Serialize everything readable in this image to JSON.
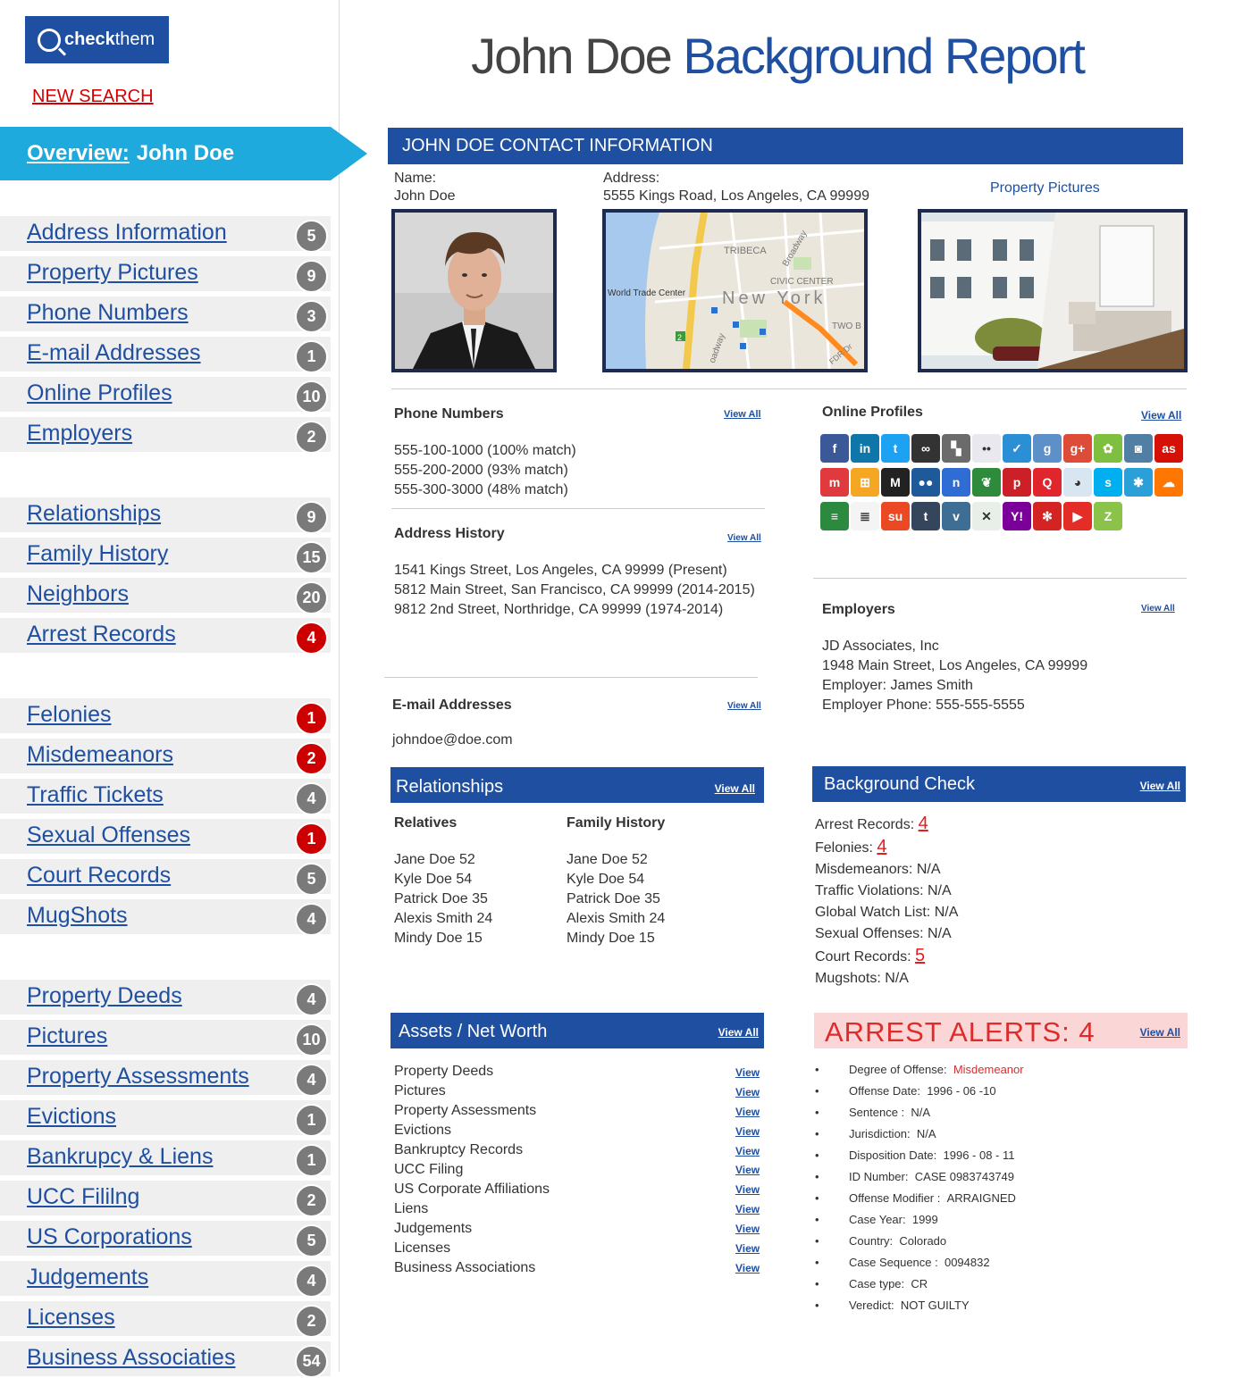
{
  "brand": {
    "logo_bold": "check",
    "logo_rest": "them"
  },
  "sidebar": {
    "new_search": "NEW SEARCH",
    "overview_prefix": "Overview:",
    "overview_name": "John Doe",
    "groups": [
      [
        {
          "label": "Address Information",
          "count": "5",
          "alert": false
        },
        {
          "label": "Property Pictures",
          "count": "9",
          "alert": false
        },
        {
          "label": "Phone Numbers",
          "count": "3",
          "alert": false
        },
        {
          "label": "E-mail Addresses",
          "count": "1",
          "alert": false
        },
        {
          "label": "Online Profiles",
          "count": "10",
          "alert": false
        },
        {
          "label": "Employers",
          "count": "2",
          "alert": false
        }
      ],
      [
        {
          "label": "Relationships",
          "count": "9",
          "alert": false
        },
        {
          "label": "Family History",
          "count": "15",
          "alert": false
        },
        {
          "label": "Neighbors",
          "count": "20",
          "alert": false
        },
        {
          "label": "Arrest Records",
          "count": "4",
          "alert": true
        }
      ],
      [
        {
          "label": "Felonies",
          "count": "1",
          "alert": true
        },
        {
          "label": "Misdemeanors",
          "count": "2",
          "alert": true
        },
        {
          "label": "Traffic Tickets",
          "count": "4",
          "alert": false
        },
        {
          "label": "Sexual Offenses",
          "count": "1",
          "alert": true
        },
        {
          "label": "Court Records",
          "count": "5",
          "alert": false
        },
        {
          "label": "MugShots",
          "count": "4",
          "alert": false
        }
      ],
      [
        {
          "label": "Property Deeds",
          "count": "4",
          "alert": false
        },
        {
          "label": "Pictures",
          "count": "10",
          "alert": false
        },
        {
          "label": "Property Assessments",
          "count": "4",
          "alert": false
        },
        {
          "label": "Evictions",
          "count": "1",
          "alert": false
        },
        {
          "label": "Bankrupcy & Liens",
          "count": "1",
          "alert": false
        },
        {
          "label": "UCC Fililng",
          "count": "2",
          "alert": false
        },
        {
          "label": "US Corporations",
          "count": "5",
          "alert": false
        },
        {
          "label": "Judgements",
          "count": "4",
          "alert": false
        },
        {
          "label": "Licenses",
          "count": "2",
          "alert": false
        },
        {
          "label": "Business Associaties",
          "count": "54",
          "alert": false
        }
      ]
    ]
  },
  "title": {
    "name": "John Doe",
    "rest": "Background Report"
  },
  "contact": {
    "header": "JOHN DOE CONTACT INFORMATION",
    "name_label": "Name:",
    "name_value": "John Doe",
    "address_label": "Address:",
    "address_value": "5555 Kings Road, Los Angeles, CA 99999",
    "property_pictures": "Property Pictures",
    "map_labels": {
      "a": "TRIBECA",
      "b": "CIVIC CENTER",
      "c": "World Trade Center",
      "d": "New York",
      "e": "TWO B",
      "f": "Broadway",
      "g": "FDR Dr",
      "h": "oadway",
      "i": "2"
    }
  },
  "view_all": "View All",
  "view": "View",
  "phones": {
    "title": "Phone Numbers",
    "items": [
      "555-100-1000 (100% match)",
      "555-200-2000 (93% match)",
      "555-300-3000 (48% match)"
    ]
  },
  "addresses": {
    "title": "Address History",
    "items": [
      "1541 Kings Street, Los Angeles, CA 99999 (Present)",
      "5812 Main Street, San Francisco, CA 99999 (2014-2015)",
      "9812 2nd Street, Northridge, CA 99999 (1974-2014)"
    ]
  },
  "emails": {
    "title": "E-mail Addresses",
    "items": [
      "johndoe@doe.com"
    ]
  },
  "online": {
    "title": "Online Profiles",
    "icons": [
      {
        "name": "facebook-icon",
        "glyph": "f",
        "color": "#3b5998"
      },
      {
        "name": "linkedin-icon",
        "glyph": "in",
        "color": "#0e76a8"
      },
      {
        "name": "twitter-icon",
        "glyph": "t",
        "color": "#1da1f2"
      },
      {
        "name": "myspace-icon",
        "glyph": "∞",
        "color": "#333333"
      },
      {
        "name": "delicious-icon",
        "glyph": "▚",
        "color": "#6b6b6b"
      },
      {
        "name": "flickr-icon",
        "glyph": "••",
        "color": "#e8e8ee"
      },
      {
        "name": "foursquare-icon",
        "glyph": "✓",
        "color": "#2b8fd6"
      },
      {
        "name": "goodreads-icon",
        "glyph": "g",
        "color": "#5d8fc9"
      },
      {
        "name": "googleplus-icon",
        "glyph": "g+",
        "color": "#dd4b39"
      },
      {
        "name": "icq-icon",
        "glyph": "✿",
        "color": "#7fbf3f"
      },
      {
        "name": "instagram-icon",
        "glyph": "◙",
        "color": "#517fa4"
      },
      {
        "name": "lastfm-icon",
        "glyph": "as",
        "color": "#d51007"
      },
      {
        "name": "meetup-icon",
        "glyph": "m",
        "color": "#e0393e"
      },
      {
        "name": "windows-icon",
        "glyph": "⊞",
        "color": "#f5a623"
      },
      {
        "name": "myheritage-icon",
        "glyph": "M",
        "color": "#222222"
      },
      {
        "name": "myspace-people-icon",
        "glyph": "●●",
        "color": "#1e5a9a"
      },
      {
        "name": "netlog-icon",
        "glyph": "n",
        "color": "#2f6dd5"
      },
      {
        "name": "evernote-icon",
        "glyph": "❦",
        "color": "#2e8b3b"
      },
      {
        "name": "pinterest-icon",
        "glyph": "p",
        "color": "#cb2027"
      },
      {
        "name": "quora-icon",
        "glyph": "Q",
        "color": "#e0252d"
      },
      {
        "name": "reddit-icon",
        "glyph": "◕",
        "color": "#d8e6f2"
      },
      {
        "name": "skype-icon",
        "glyph": "s",
        "color": "#00aff0"
      },
      {
        "name": "stumble-people-icon",
        "glyph": "✱",
        "color": "#2a9fd8"
      },
      {
        "name": "soundcloud-icon",
        "glyph": "☁",
        "color": "#ff7700"
      },
      {
        "name": "spotify-icon",
        "glyph": "≡",
        "color": "#2b8a3e"
      },
      {
        "name": "stackoverflow-icon",
        "glyph": "≣",
        "color": "#f4f4f4"
      },
      {
        "name": "stumbleupon-icon",
        "glyph": "su",
        "color": "#eb4924"
      },
      {
        "name": "tumblr-icon",
        "glyph": "t",
        "color": "#35465c"
      },
      {
        "name": "vimeo-icon",
        "glyph": "v",
        "color": "#3e6e93"
      },
      {
        "name": "xing-icon",
        "glyph": "✕",
        "color": "#e8eee8"
      },
      {
        "name": "yahoo-icon",
        "glyph": "Y!",
        "color": "#7b0099"
      },
      {
        "name": "yelp-icon",
        "glyph": "✻",
        "color": "#d32323"
      },
      {
        "name": "youtube-icon",
        "glyph": "▶",
        "color": "#e52d27"
      },
      {
        "name": "zerply-icon",
        "glyph": "Z",
        "color": "#8bc34a"
      }
    ]
  },
  "employers": {
    "title": "Employers",
    "items": [
      "JD Associates, Inc",
      "1948 Main Street, Los Angeles, CA 99999",
      "Employer: James Smith",
      "Employer Phone: 555-555-5555"
    ]
  },
  "relationships": {
    "title": "Relationships",
    "relatives_label": "Relatives",
    "family_label": "Family History",
    "relatives": [
      "Jane Doe 52",
      "Kyle Doe 54",
      "Patrick Doe 35",
      "Alexis Smith 24",
      "Mindy Doe 15"
    ],
    "family": [
      "Jane Doe 52",
      "Kyle Doe 54",
      "Patrick Doe 35",
      "Alexis Smith 24",
      "Mindy Doe 15"
    ]
  },
  "background": {
    "title": "Background Check",
    "items": [
      {
        "label": "Arrest Records:",
        "value": "4",
        "highlight": true
      },
      {
        "label": "Felonies:",
        "value": "4",
        "highlight": true
      },
      {
        "label": "Misdemeanors:",
        "value": "N/A",
        "highlight": false
      },
      {
        "label": "Traffic Violations:",
        "value": "N/A",
        "highlight": false
      },
      {
        "label": "Global Watch List:",
        "value": "N/A",
        "highlight": false
      },
      {
        "label": "Sexual Offenses:",
        "value": "N/A",
        "highlight": false
      },
      {
        "label": "Court Records:",
        "value": "5",
        "highlight": true
      },
      {
        "label": "Mugshots:",
        "value": "N/A",
        "highlight": false
      }
    ]
  },
  "assets": {
    "title": "Assets / Net Worth",
    "items": [
      "Property Deeds",
      "Pictures",
      "Property Assessments",
      "Evictions",
      "Bankruptcy Records",
      "UCC Filing",
      "US Corporate Affiliations",
      "Liens",
      "Judgements",
      "Licenses",
      "Business Associations"
    ]
  },
  "arrest": {
    "title": "ARREST ALERTS: 4",
    "bullet": "•",
    "items": [
      {
        "label": "Degree  of  Offense:",
        "value": "Misdemeanor",
        "red": true
      },
      {
        "label": "Offense Date:",
        "value": "1996 - 06 -10",
        "red": false
      },
      {
        "label": "Sentence :",
        "value": "N/A",
        "red": false
      },
      {
        "label": "Jurisdiction:",
        "value": "N/A",
        "red": false
      },
      {
        "label": "Disposition Date:",
        "value": "1996 - 08 - 11",
        "red": false
      },
      {
        "label": "ID Number:",
        "value": "CASE 0983743749",
        "red": false
      },
      {
        "label": "Offense Modifier :",
        "value": "ARRAIGNED",
        "red": false
      },
      {
        "label": "Case Year:",
        "value": "1999",
        "red": false
      },
      {
        "label": "Country:",
        "value": "Colorado",
        "red": false
      },
      {
        "label": "Case Sequence :",
        "value": "0094832",
        "red": false
      },
      {
        "label": "Case type:",
        "value": "CR",
        "red": false
      },
      {
        "label": "Veredict:",
        "value": "NOT GUILTY",
        "red": false
      }
    ]
  }
}
